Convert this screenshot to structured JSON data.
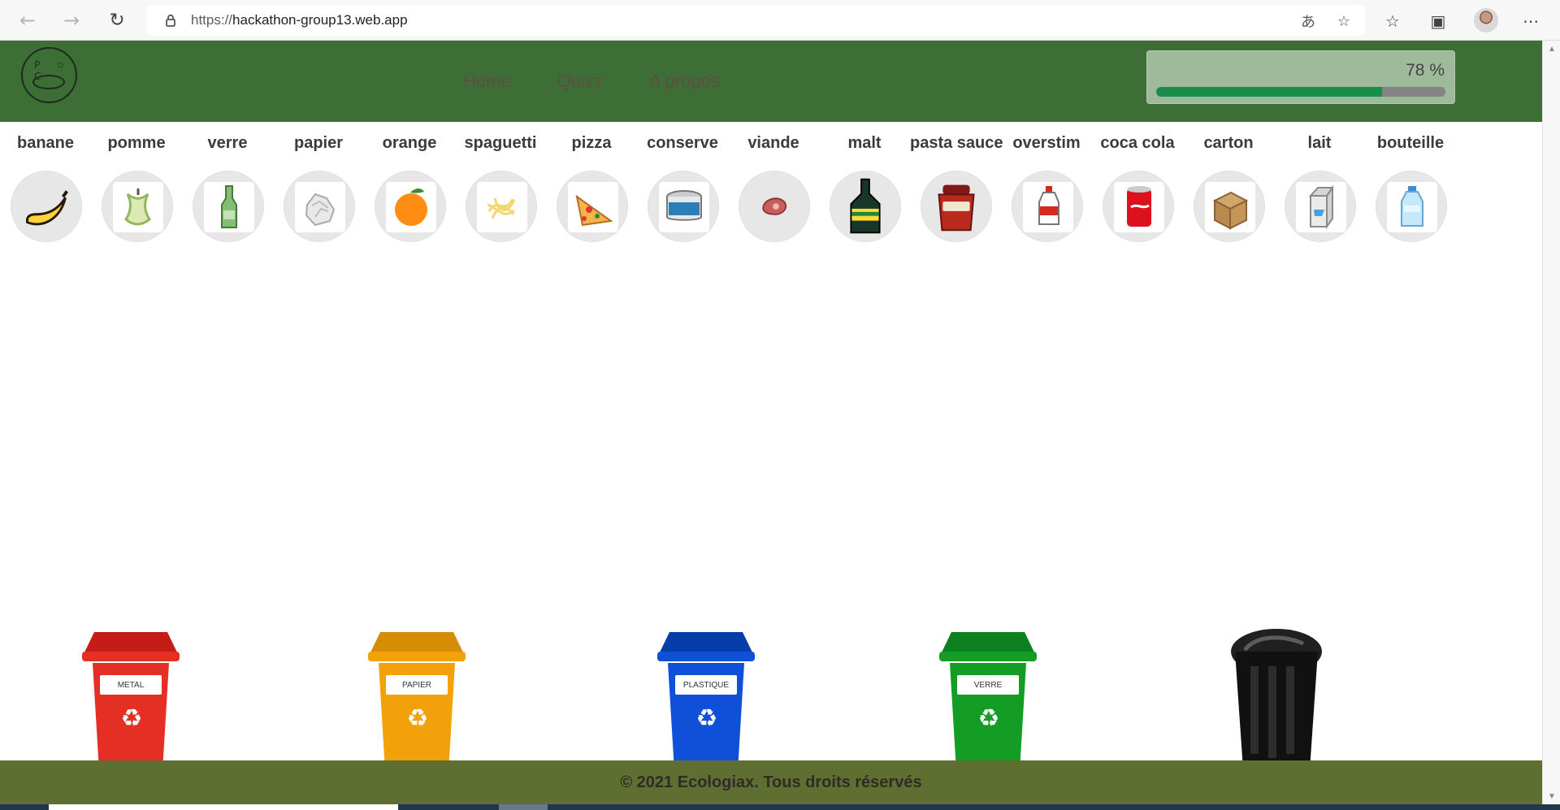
{
  "browser": {
    "url_prefix": "https://",
    "url_host": "hackathon-group13.web.app"
  },
  "header": {
    "logo_text": "P ☆ C",
    "menu": [
      {
        "label": "Home"
      },
      {
        "label": "Quizz"
      },
      {
        "label": "A propos"
      }
    ],
    "progress": {
      "label": "78 %",
      "value": 78
    }
  },
  "items": [
    {
      "label": "banane",
      "icon": "banana-icon"
    },
    {
      "label": "pomme",
      "icon": "apple-core-icon"
    },
    {
      "label": "verre",
      "icon": "glass-bottle-icon"
    },
    {
      "label": "papier",
      "icon": "crumpled-paper-icon"
    },
    {
      "label": "orange",
      "icon": "orange-icon"
    },
    {
      "label": "spaguetti",
      "icon": "spaghetti-icon"
    },
    {
      "label": "pizza",
      "icon": "pizza-icon"
    },
    {
      "label": "conserve",
      "icon": "tin-can-icon"
    },
    {
      "label": "viande",
      "icon": "meat-icon"
    },
    {
      "label": "malt",
      "icon": "malt-bottle-icon"
    },
    {
      "label": "pasta sauce",
      "icon": "sauce-jar-icon"
    },
    {
      "label": "overstim",
      "icon": "drink-bottle-icon"
    },
    {
      "label": "coca cola",
      "icon": "soda-can-icon"
    },
    {
      "label": "carton",
      "icon": "cardboard-box-icon"
    },
    {
      "label": "lait",
      "icon": "milk-carton-icon"
    },
    {
      "label": "bouteille",
      "icon": "plastic-bottle-icon"
    }
  ],
  "bins": [
    {
      "label": "METAL",
      "color": "#e42f25"
    },
    {
      "label": "PAPIER",
      "color": "#f2a10a"
    },
    {
      "label": "PLASTIQUE",
      "color": "#1050d8"
    },
    {
      "label": "VERRE",
      "color": "#139d25"
    }
  ],
  "footer": {
    "text": "© 2021 Ecologiax. Tous droits réservés"
  }
}
